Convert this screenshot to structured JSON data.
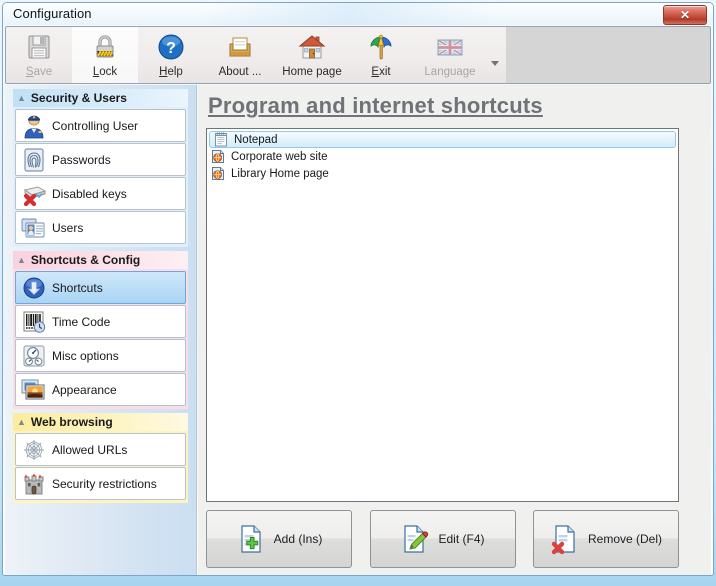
{
  "window": {
    "title": "Configuration",
    "close_label": "✕"
  },
  "toolbar": {
    "buttons": [
      {
        "label": "Save",
        "accel": "S",
        "icon": "floppy-disk-icon",
        "disabled": true
      },
      {
        "label": "Lock",
        "accel": "L",
        "icon": "padlock-icon",
        "disabled": false
      },
      {
        "label": "Help",
        "accel": "H",
        "icon": "question-circle-icon",
        "disabled": false
      },
      {
        "label": "About ...",
        "accel": "",
        "icon": "inbox-tray-icon",
        "disabled": false
      },
      {
        "label": "Home page",
        "accel": "",
        "icon": "house-icon",
        "disabled": false
      },
      {
        "label": "Exit",
        "accel": "E",
        "icon": "parasol-icon",
        "disabled": false
      },
      {
        "label": "Language",
        "accel": "",
        "icon": "uk-flag-icon",
        "disabled": true
      }
    ],
    "language_caret": "chevron-down-icon"
  },
  "sidebar": {
    "groups": [
      {
        "title": "Security & Users",
        "color": "blue",
        "items": [
          {
            "label": "Controlling User",
            "icon": "police-user-icon",
            "selected": false
          },
          {
            "label": "Passwords",
            "icon": "fingerprint-icon",
            "selected": false
          },
          {
            "label": "Disabled keys",
            "icon": "disabled-keys-icon",
            "selected": false
          },
          {
            "label": "Users",
            "icon": "users-cards-icon",
            "selected": false
          }
        ]
      },
      {
        "title": "Shortcuts & Config",
        "color": "pink",
        "items": [
          {
            "label": "Shortcuts",
            "icon": "download-arrow-icon",
            "selected": true
          },
          {
            "label": "Time Code",
            "icon": "barcode-clock-icon",
            "selected": false
          },
          {
            "label": "Misc options",
            "icon": "gauges-icon",
            "selected": false
          },
          {
            "label": "Appearance",
            "icon": "photo-sunset-icon",
            "selected": false
          }
        ]
      },
      {
        "title": "Web browsing",
        "color": "yellow",
        "items": [
          {
            "label": "Allowed URLs",
            "icon": "spider-web-icon",
            "selected": false
          },
          {
            "label": "Security restrictions",
            "icon": "castle-icon",
            "selected": false
          }
        ]
      }
    ]
  },
  "main": {
    "title": "Program and internet shortcuts",
    "list": [
      {
        "label": "Notepad",
        "icon": "notepad-icon",
        "selected": true
      },
      {
        "label": "Corporate web site",
        "icon": "internet-shortcut-icon",
        "selected": false
      },
      {
        "label": "Library Home page",
        "icon": "internet-shortcut-icon",
        "selected": false
      }
    ],
    "actions": [
      {
        "label": "Add (Ins)",
        "icon": "page-add-icon"
      },
      {
        "label": "Edit (F4)",
        "icon": "page-edit-icon"
      },
      {
        "label": "Remove (Del)",
        "icon": "page-remove-icon"
      }
    ]
  },
  "colors": {
    "group_blue": "#bfe0f5",
    "group_pink": "#f9d2de",
    "group_yellow": "#fced9c",
    "selection": "#a9d4f4",
    "title_grey": "#6f7276",
    "close_red": "#c8503e"
  }
}
